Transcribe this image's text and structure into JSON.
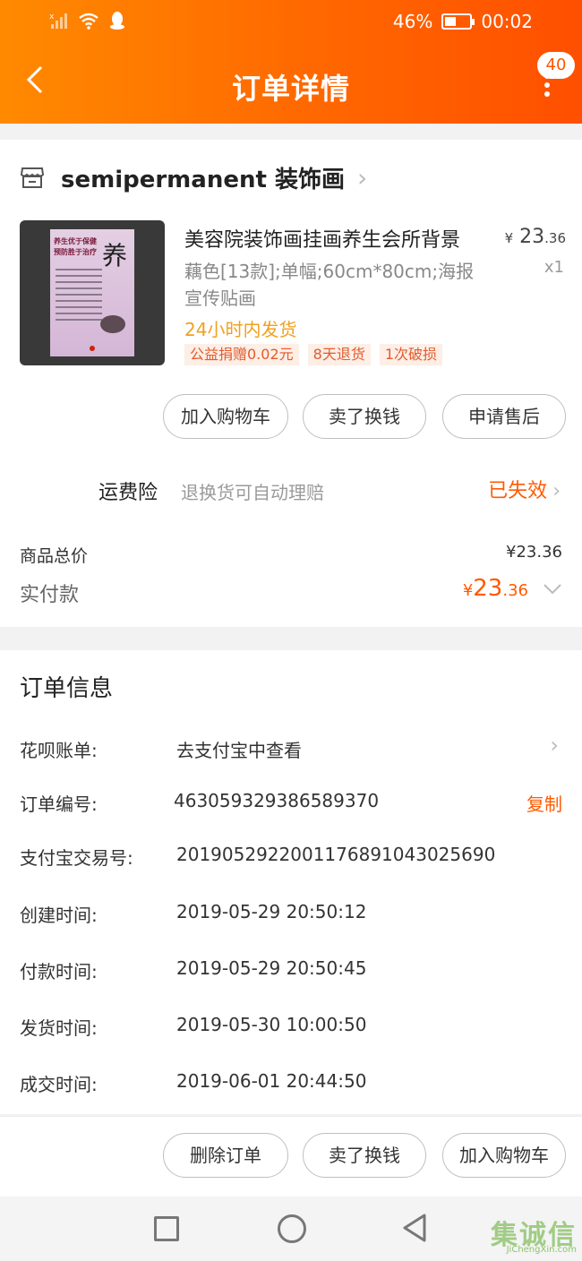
{
  "status_bar": {
    "battery": "46%",
    "time": "00:02",
    "battery_level": 0.46
  },
  "header": {
    "title": "订单详情",
    "badge": "40"
  },
  "shop": {
    "name": "semipermanent 装饰画"
  },
  "product": {
    "title": "美容院装饰画挂画养生会所背景",
    "price_symbol": "¥",
    "price_int": "23",
    "price_dec": ".36",
    "spec": "藕色[13款];单幅;60cm*80cm;海报宣传贴画",
    "qty": "x1",
    "ship": "24小时内发货",
    "tags": [
      "公益捐赠0.02元",
      "8天退货",
      "1次破损"
    ],
    "poster_text": "养生优于保健\n预防胜于治疗",
    "poster_big": "养"
  },
  "item_actions": [
    "加入购物车",
    "卖了换钱",
    "申请售后"
  ],
  "insurance": {
    "label": "运费险",
    "desc": "退换货可自动理赔",
    "status": "已失效"
  },
  "totals": {
    "goods_label": "商品总价",
    "goods_value": "¥23.36",
    "paid_label": "实付款",
    "paid_symbol": "¥",
    "paid_int": "23",
    "paid_dec": ".36"
  },
  "order_info": {
    "title": "订单信息",
    "rows": [
      {
        "key": "花呗账单:",
        "value": "去支付宝中查看"
      },
      {
        "key": "订单编号:",
        "value": "463059329386589370",
        "action": "复制"
      },
      {
        "key": "支付宝交易号:",
        "value": "2019052922001176891043025690"
      },
      {
        "key": "创建时间:",
        "value": "2019-05-29 20:50:12"
      },
      {
        "key": "付款时间:",
        "value": "2019-05-29 20:50:45"
      },
      {
        "key": "发货时间:",
        "value": "2019-05-30 10:00:50"
      },
      {
        "key": "成交时间:",
        "value": "2019-06-01 20:44:50"
      }
    ]
  },
  "bottom_actions": [
    "删除订单",
    "卖了换钱",
    "加入购物车"
  ],
  "watermark": {
    "text": "集诚信",
    "url": "JiChengXin.com"
  },
  "colors": {
    "accent": "#ff6a00",
    "price": "#ff5a00",
    "ship": "#f0a020"
  }
}
